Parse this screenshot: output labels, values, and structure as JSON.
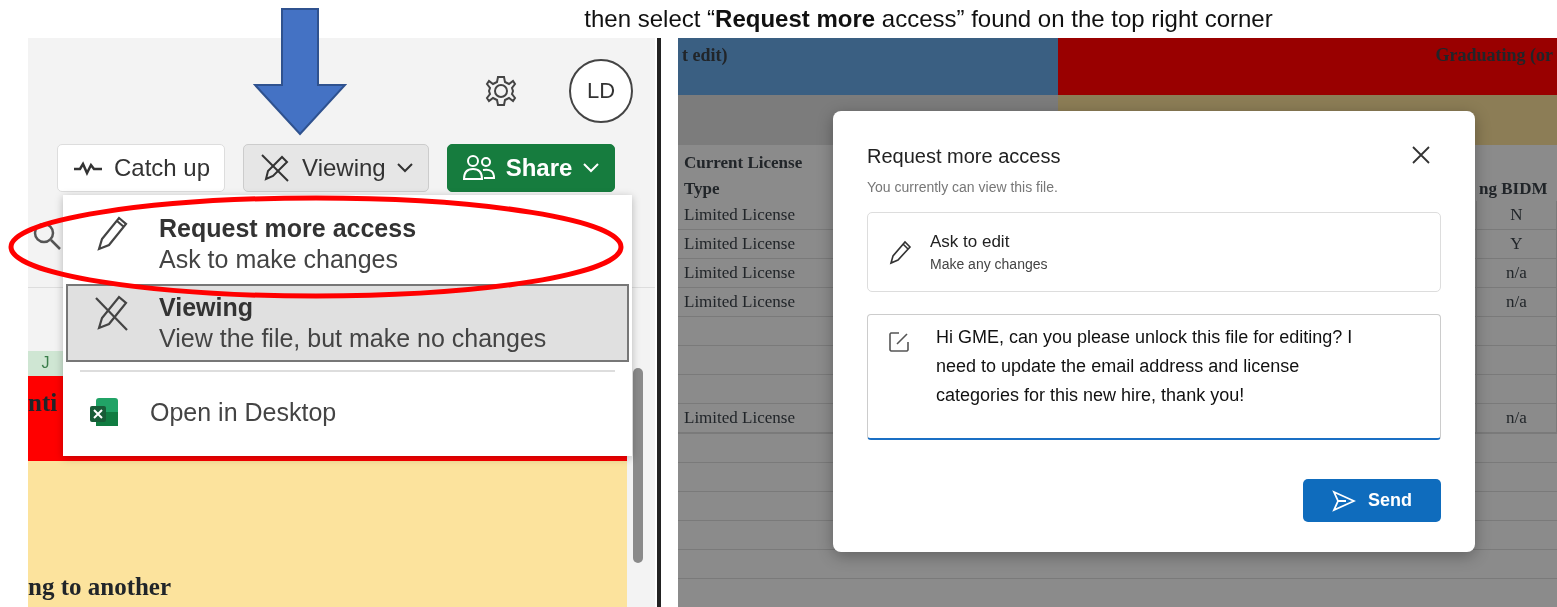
{
  "caption": "then select “**Request more** access” found on the top right corner",
  "left_screenshot": {
    "avatar": "LD",
    "toolbar": [
      {
        "label": "Catch up",
        "kind": "plain"
      },
      {
        "label": "Viewing",
        "kind": "mode"
      },
      {
        "label": "Share",
        "kind": "primary"
      }
    ],
    "menu": {
      "groups": [
        [
          {
            "title": "Request more access",
            "subtitle": "Ask to make changes",
            "kind": "pencil",
            "selected": false
          },
          {
            "title": "Viewing",
            "subtitle": "View the file, but make no changes",
            "kind": "no-edit",
            "selected": true
          }
        ],
        [
          {
            "title": "Open in Desktop",
            "kind": "excel",
            "selected": false
          }
        ]
      ]
    },
    "sheet": {
      "column_header": "J",
      "red_cell": "nti",
      "yellow_cell": "ng to another"
    }
  },
  "right_screenshot": {
    "sheet": {
      "header_cells": [
        "t edit)",
        "Graduating (or"
      ],
      "column_1_heading": "Current License Type",
      "column_7_heading": "ng BIDM",
      "rows": [
        {
          "kind": "data",
          "license": "Limited License",
          "value": "N"
        },
        {
          "kind": "data",
          "license": "Limited License",
          "value": "Y"
        },
        {
          "kind": "data",
          "license": "Limited License",
          "value": "n/a"
        },
        {
          "kind": "data",
          "license": "Limited License",
          "value": "n/a"
        },
        {
          "kind": "blank"
        },
        {
          "kind": "blank"
        },
        {
          "kind": "blank"
        },
        {
          "kind": "data",
          "license": "Limited License",
          "value": "n/a"
        }
      ]
    },
    "dialog": {
      "title": "Request more access",
      "subtitle": "You currently can view this file.",
      "option": {
        "title": "Ask to edit",
        "subtitle": "Make any changes"
      },
      "message": "Hi GME, can you please unlock this file for editing? I need to update the email address and license categories for this new hire, thank you!",
      "send": "Send"
    }
  }
}
